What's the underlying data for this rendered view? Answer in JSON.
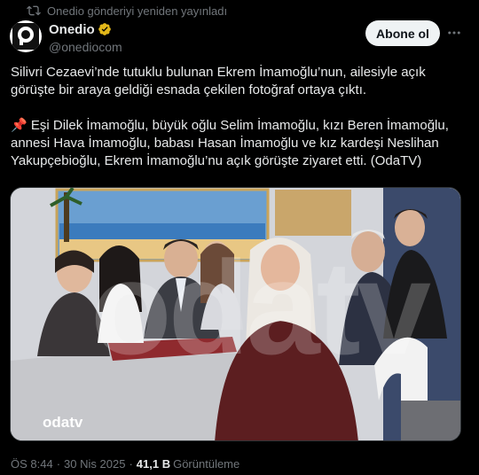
{
  "repost": {
    "icon": "repost-icon",
    "text": "Onedio gönderiyi yeniden yayınladı"
  },
  "author": {
    "name": "Onedio",
    "handle": "@onediocom",
    "verified_badge_color": "#e2b719"
  },
  "follow_label": "Abone ol",
  "more_icon": "more-horizontal-icon",
  "tweet": {
    "paragraph1": "Silivri Cezaevi’nde tutuklu bulunan Ekrem İmamoğlu’nun, ailesiyle açık görüşte bir araya geldiği esnada çekilen fotoğraf ortaya çıktı.",
    "pin_emoji": "📌",
    "paragraph2": "Eşi Dilek İmamoğlu, büyük oğlu Selim İmamoğlu, kızı Beren İmamoğlu, annesi Hava İmamoğlu, babası Hasan İmamoğlu ve kız kardeşi Neslihan Yakupçebioğlu, Ekrem İmamoğlu’nu açık görüşte ziyaret etti. (OdaTV)"
  },
  "photo": {
    "watermark_large": "odatv",
    "watermark_corner": "odatv"
  },
  "meta": {
    "time": "ÖS 8:44",
    "separator": "·",
    "date": "30 Nis 2025",
    "views_count": "41,1 B",
    "views_label": "Görüntüleme"
  }
}
